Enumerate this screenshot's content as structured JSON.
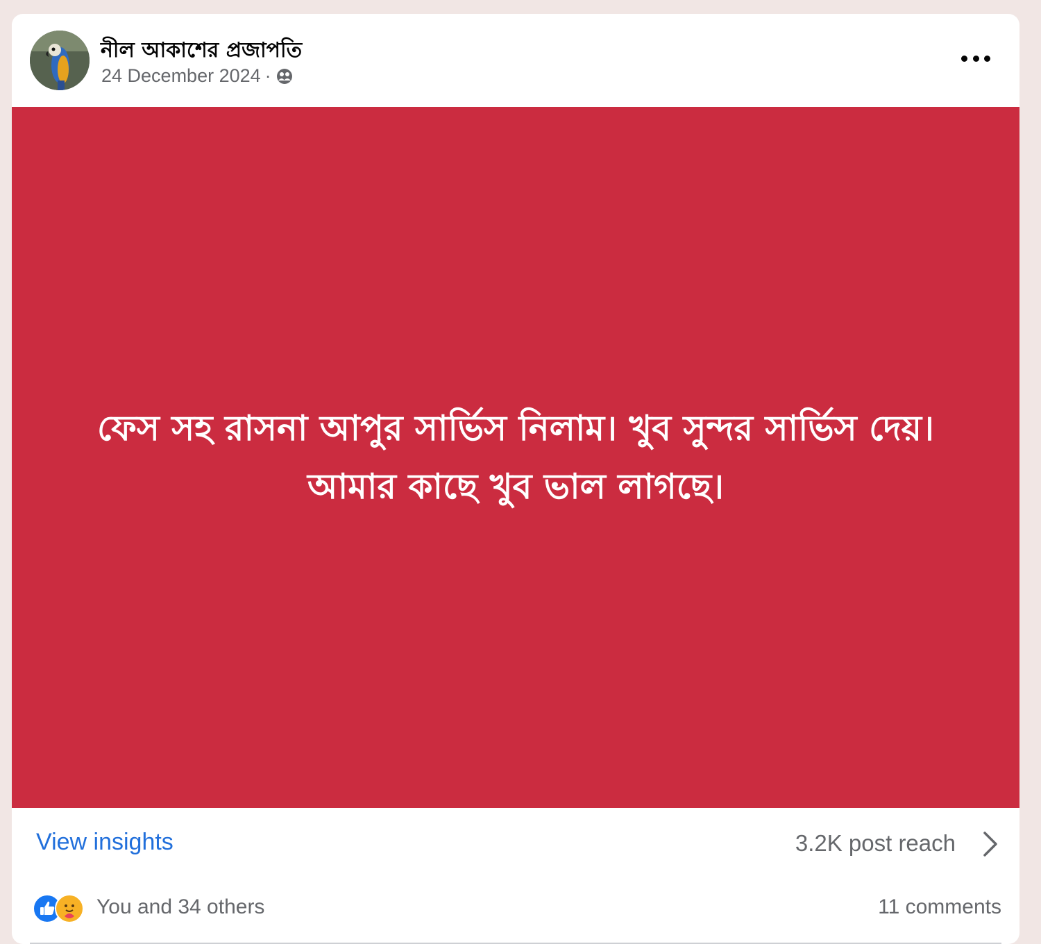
{
  "post": {
    "author": "নীল আকাশের প্রজাপতি",
    "date": "24 December 2024",
    "separator": "·",
    "audience_icon": "friends-icon",
    "more_icon": "more-dots-icon",
    "background_color": "#cb2c40",
    "text": "ফেস সহ রাসনা আপুর সার্ভিস নিলাম। খুব সুন্দর সার্ভিস দেয়।\nআমার কাছে খুব ভাল লাগছে।"
  },
  "insights": {
    "link_label": "View insights",
    "reach_label": "3.2K post reach"
  },
  "engagement": {
    "reaction_icons": [
      "like-icon",
      "care-icon"
    ],
    "reactions_text": "You and 34 others",
    "comments_text": "11 comments"
  },
  "colors": {
    "link_blue": "#216fdb",
    "meta_gray": "#65676b",
    "like_blue": "#1877f2",
    "care_yellow": "#f7b125"
  }
}
